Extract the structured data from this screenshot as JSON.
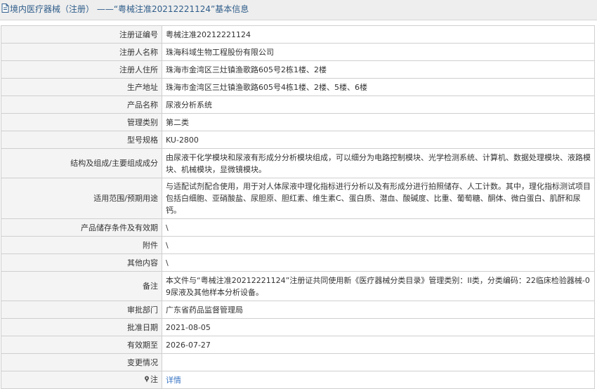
{
  "header": {
    "title": "境内医疗器械（注册） ——“粤械注准20212221124”基本信息"
  },
  "rows": [
    {
      "label": "注册证编号",
      "value": "粤械注准20212221124"
    },
    {
      "label": "注册人名称",
      "value": "珠海科域生物工程股份有限公司"
    },
    {
      "label": "注册人住所",
      "value": "珠海市金湾区三灶镇渔歌路605号2栋1楼、2楼"
    },
    {
      "label": "生产地址",
      "value": "珠海市金湾区三灶镇渔歌路605号4栋1楼、2楼、5楼、6楼"
    },
    {
      "label": "产品名称",
      "value": "尿液分析系统"
    },
    {
      "label": "管理类别",
      "value": "第二类"
    },
    {
      "label": "型号规格",
      "value": "KU-2800"
    },
    {
      "label": "结构及组成/主要组成成分",
      "value": "由尿液干化学模块和尿液有形成分分析模块组成，可以细分为电路控制模块、光学检测系统、计算机、数据处理模块、液路模块、机械模块，显微镜模块。"
    },
    {
      "label": "适用范围/预期用途",
      "value": "与适配试剂配合使用，用于对人体尿液中理化指标进行分析以及有形成分进行拍照储存、人工计数。其中，理化指标测试项目包括白细胞、亚硝酸盐、尿胆原、胆红素、维生素C、蛋白质、潜血、酸碱度、比重、葡萄糖、酮体、微白蛋白、肌酐和尿钙。"
    },
    {
      "label": "产品储存条件及有效期",
      "value": "\\"
    },
    {
      "label": "附件",
      "value": "\\"
    },
    {
      "label": "其他内容",
      "value": "\\"
    },
    {
      "label": "备注",
      "value": "本文件与“粤械注准20212221124”注册证共同使用新《医疗器械分类目录》管理类别：II类，分类编码：22临床检验器械-09尿液及其他样本分析设备。"
    },
    {
      "label": "审批部门",
      "value": "广东省药品监督管理局"
    },
    {
      "label": "批准日期",
      "value": "2021-08-05"
    },
    {
      "label": "有效期至",
      "value": "2026-07-27"
    },
    {
      "label": "变更情况",
      "value": ""
    }
  ],
  "note": {
    "label": "注",
    "link_text": "详情"
  },
  "colors": {
    "title_text": "#2f5d8a",
    "link": "#3a75c4",
    "label_bg": "#f4f4f4",
    "border": "#cfcfcf"
  },
  "icons": {
    "title_icon": "document-icon",
    "note_icon": "pin-icon"
  }
}
